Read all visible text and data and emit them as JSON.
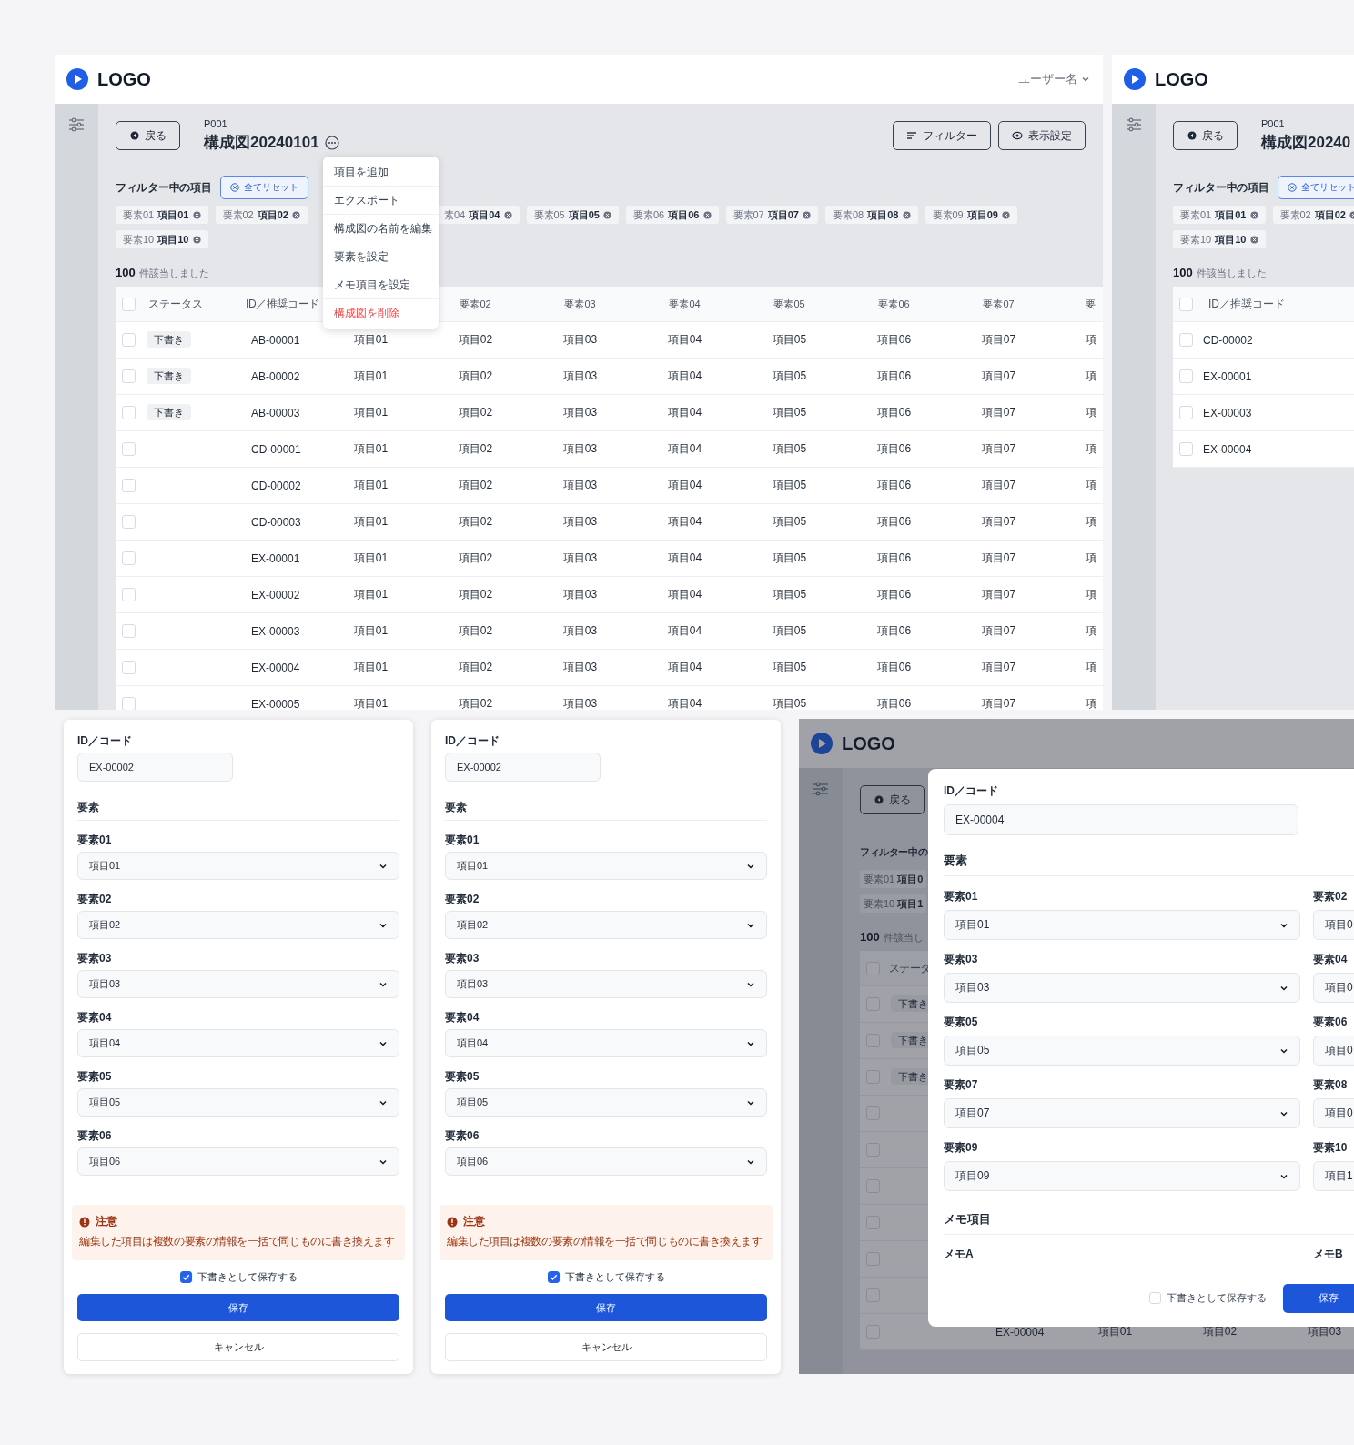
{
  "main_screen": {
    "logo": "LOGO",
    "user_menu": "ユーザー名",
    "back_button": "戻る",
    "code": "P001",
    "title": "構成図20240101",
    "actions": [
      {
        "kind": "filter",
        "label": "フィルター"
      },
      {
        "kind": "view",
        "label": "表示設定"
      }
    ],
    "menu": [
      {
        "label": "項目を追加",
        "kind": "normal",
        "divider_below": true
      },
      {
        "label": "エクスポート",
        "kind": "normal",
        "divider_below": true
      },
      {
        "label": "構成図の名前を編集",
        "kind": "normal",
        "divider_below": false
      },
      {
        "label": "要素を設定",
        "kind": "normal",
        "divider_below": false
      },
      {
        "label": "メモ項目を設定",
        "kind": "normal",
        "divider_below": true
      },
      {
        "label": "構成図を削除",
        "kind": "danger",
        "divider_below": false
      }
    ],
    "filter_label": "フィルター中の項目",
    "reset_button": "全てリセット",
    "chip_rows": [
      [
        {
          "key": "要素01",
          "value": "項目01"
        },
        {
          "key": "要素02",
          "value": "項目02"
        },
        {
          "key": "素04",
          "value": "項目04"
        },
        {
          "key": "要素05",
          "value": "項目05"
        },
        {
          "key": "要素06",
          "value": "項目06"
        },
        {
          "key": "要素07",
          "value": "項目07"
        },
        {
          "key": "要素08",
          "value": "項目08"
        },
        {
          "key": "要素09",
          "value": "項目09"
        }
      ],
      [
        {
          "key": "要素10",
          "value": "項目10"
        }
      ]
    ],
    "result_count": "100",
    "result_text": "件該当しました",
    "table": {
      "header_checked": false,
      "columns": [
        "ステータス",
        "ID／推奨コード"
      ],
      "element_columns": [
        "要素02",
        "要素03",
        "要素04",
        "要素05",
        "要素06",
        "要素07",
        "要"
      ],
      "rows": [
        {
          "checked": false,
          "status": "下書き",
          "id": "AB-00001",
          "cells": [
            "項目01",
            "項目02",
            "項目03",
            "項目04",
            "項目05",
            "項目06",
            "項目07",
            "項"
          ]
        },
        {
          "checked": false,
          "status": "下書き",
          "id": "AB-00002",
          "cells": [
            "項目01",
            "項目02",
            "項目03",
            "項目04",
            "項目05",
            "項目06",
            "項目07",
            "項"
          ]
        },
        {
          "checked": false,
          "status": "下書き",
          "id": "AB-00003",
          "cells": [
            "項目01",
            "項目02",
            "項目03",
            "項目04",
            "項目05",
            "項目06",
            "項目07",
            "項"
          ]
        },
        {
          "checked": false,
          "id": "CD-00001",
          "cells": [
            "項目01",
            "項目02",
            "項目03",
            "項目04",
            "項目05",
            "項目06",
            "項目07",
            "項"
          ]
        },
        {
          "checked": false,
          "id": "CD-00002",
          "cells": [
            "項目01",
            "項目02",
            "項目03",
            "項目04",
            "項目05",
            "項目06",
            "項目07",
            "項"
          ]
        },
        {
          "checked": false,
          "id": "CD-00003",
          "cells": [
            "項目01",
            "項目02",
            "項目03",
            "項目04",
            "項目05",
            "項目06",
            "項目07",
            "項"
          ]
        },
        {
          "checked": false,
          "id": "EX-00001",
          "cells": [
            "項目01",
            "項目02",
            "項目03",
            "項目04",
            "項目05",
            "項目06",
            "項目07",
            "項"
          ]
        },
        {
          "checked": false,
          "id": "EX-00002",
          "cells": [
            "項目01",
            "項目02",
            "項目03",
            "項目04",
            "項目05",
            "項目06",
            "項目07",
            "項"
          ]
        },
        {
          "checked": false,
          "id": "EX-00003",
          "cells": [
            "項目01",
            "項目02",
            "項目03",
            "項目04",
            "項目05",
            "項目06",
            "項目07",
            "項"
          ]
        },
        {
          "checked": false,
          "id": "EX-00004",
          "cells": [
            "項目01",
            "項目02",
            "項目03",
            "項目04",
            "項目05",
            "項目06",
            "項目07",
            "項"
          ]
        },
        {
          "checked": false,
          "id": "EX-00005",
          "cells": [
            "項目01",
            "項目02",
            "項目03",
            "項目04",
            "項目05",
            "項目06",
            "項目07",
            "項"
          ]
        }
      ]
    }
  },
  "narrow_screen": {
    "logo": "LOGO",
    "back_button": "戻る",
    "code": "P001",
    "title": "構成図20240",
    "filter_label": "フィルター中の項目",
    "reset_button": "全てリセット",
    "chip_rows": [
      [
        {
          "key": "要素01",
          "value": "項目01"
        },
        {
          "key": "要素02",
          "value": "項目02"
        }
      ],
      [
        {
          "key": "要素10",
          "value": "項目10"
        }
      ]
    ],
    "result_count": "100",
    "result_text": "件該当しました",
    "table": {
      "header_checked": false,
      "columns": [
        "ID／推奨コード"
      ],
      "rows": [
        {
          "checked": false,
          "id": "CD-00002"
        },
        {
          "checked": false,
          "id": "EX-00001"
        },
        {
          "checked": false,
          "id": "EX-00003"
        },
        {
          "checked": false,
          "id": "EX-00004"
        }
      ]
    }
  },
  "edit_forms": [
    {
      "id_label": "ID／コード",
      "id_value": "EX-00002",
      "section": "要素",
      "fields": [
        {
          "label": "要素01",
          "value": "項目01"
        },
        {
          "label": "要素02",
          "value": "項目02"
        },
        {
          "label": "要素03",
          "value": "項目03"
        },
        {
          "label": "要素04",
          "value": "項目04"
        },
        {
          "label": "要素05",
          "value": "項目05"
        },
        {
          "label": "要素06",
          "value": "項目06"
        }
      ],
      "notice": {
        "title": "注意",
        "text": "編集した項目は複数の要素の情報を一括で同じものに書き換えます"
      },
      "draft_checkbox": {
        "label": "下書きとして保存する",
        "checked": true
      },
      "save_button": "保存",
      "cancel_button": "キャンセル"
    },
    {
      "id_label": "ID／コード",
      "id_value": "EX-00002",
      "section": "要素",
      "fields": [
        {
          "label": "要素01",
          "value": "項目01"
        },
        {
          "label": "要素02",
          "value": "項目02"
        },
        {
          "label": "要素03",
          "value": "項目03"
        },
        {
          "label": "要素04",
          "value": "項目04"
        },
        {
          "label": "要素05",
          "value": "項目05"
        },
        {
          "label": "要素06",
          "value": "項目06"
        }
      ],
      "notice": {
        "title": "注意",
        "text": "編集した項目は複数の要素の情報を一括で同じものに書き換えます"
      },
      "draft_checkbox": {
        "label": "下書きとして保存する",
        "checked": true
      },
      "save_button": "保存",
      "cancel_button": "キャンセル"
    }
  ],
  "modal_screen": {
    "logo": "LOGO",
    "back_button": "戻る",
    "filter_label": "フィルター中の",
    "chip_rows": [
      [
        {
          "key": "要素01",
          "value": "項目0"
        }
      ],
      [
        {
          "key": "要素10",
          "value": "項目1"
        }
      ]
    ],
    "result_count": "100",
    "result_text": "件該当し",
    "table": {
      "header_checked": false,
      "columns": [
        "ステータ"
      ],
      "rows": [
        {
          "checked": false,
          "status": "下書き"
        },
        {
          "checked": false,
          "status": "下書き"
        },
        {
          "checked": false,
          "status": "下書き"
        },
        {
          "checked": false
        },
        {
          "checked": false
        },
        {
          "checked": false
        },
        {
          "checked": false
        },
        {
          "checked": false
        },
        {
          "checked": false
        },
        {
          "checked": false,
          "id": "EX-00004",
          "cells": [
            "項目01",
            "項目02",
            "項目03"
          ]
        }
      ]
    },
    "modal": {
      "id_label": "ID／コード",
      "id_value": "EX-00004",
      "section": "要素",
      "fields": [
        {
          "label": "要素01",
          "value": "項目01"
        },
        {
          "label": "要素02",
          "value": "項目0"
        },
        {
          "label": "要素03",
          "value": "項目03"
        },
        {
          "label": "要素04",
          "value": "項目0"
        },
        {
          "label": "要素05",
          "value": "項目05"
        },
        {
          "label": "要素06",
          "value": "項目0"
        },
        {
          "label": "要素07",
          "value": "項目07"
        },
        {
          "label": "要素08",
          "value": "項目0"
        },
        {
          "label": "要素09",
          "value": "項目09"
        },
        {
          "label": "要素10",
          "value": "項目1"
        }
      ],
      "memo_section": "メモ項目",
      "memo_fields": [
        "メモA",
        "メモB"
      ],
      "draft_checkbox": {
        "label": "下書きとして保存する",
        "checked": false
      },
      "save_button": "保存"
    }
  }
}
